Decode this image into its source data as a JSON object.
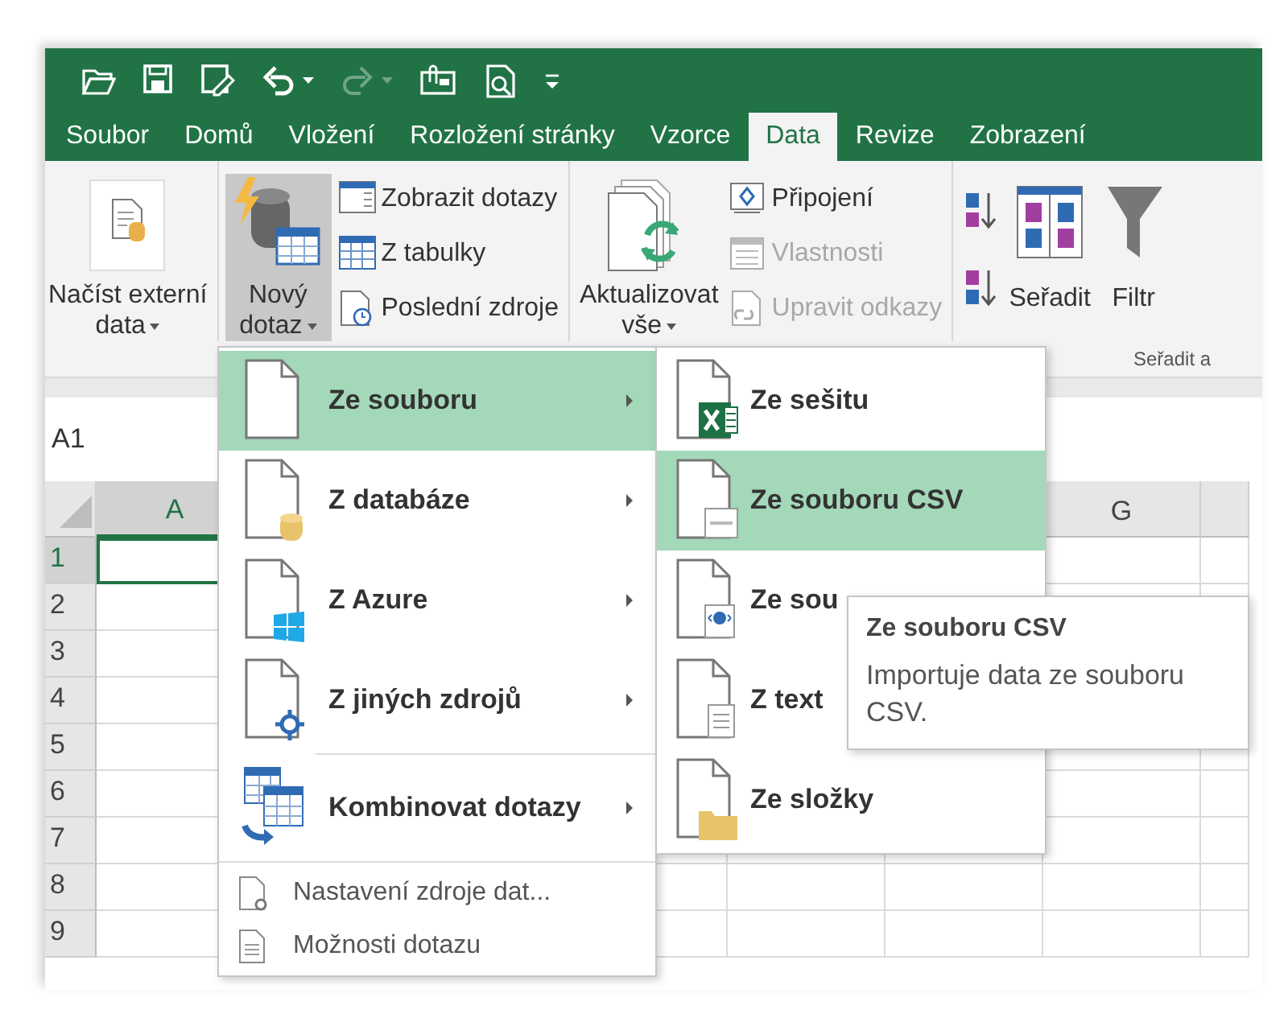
{
  "quick_access": [
    {
      "kind": "open",
      "disabled": false
    },
    {
      "kind": "save",
      "disabled": false
    },
    {
      "kind": "save-edit",
      "disabled": false
    },
    {
      "kind": "undo",
      "disabled": false
    },
    {
      "kind": "dropdown",
      "disabled": false
    },
    {
      "kind": "redo",
      "disabled": true
    },
    {
      "kind": "dropdown",
      "disabled": true
    },
    {
      "kind": "attach",
      "disabled": false
    },
    {
      "kind": "preview",
      "disabled": false
    },
    {
      "kind": "customize",
      "disabled": false
    }
  ],
  "tabs": [
    {
      "label": "Soubor",
      "selected": false
    },
    {
      "label": "Domů",
      "selected": false
    },
    {
      "label": "Vložení",
      "selected": false
    },
    {
      "label": "Rozložení stránky",
      "selected": false
    },
    {
      "label": "Vzorce",
      "selected": false
    },
    {
      "label": "Data",
      "selected": true
    },
    {
      "label": "Revize",
      "selected": false
    },
    {
      "label": "Zobrazení",
      "selected": false
    }
  ],
  "ribbon": {
    "groups": [
      {
        "large": {
          "lines": [
            "Načíst externí",
            "data"
          ],
          "dropdown": true,
          "pressed": false
        }
      },
      {
        "large": {
          "lines": [
            "Nový",
            "dotaz"
          ],
          "dropdown": true,
          "pressed": true
        },
        "small": [
          {
            "label": "Zobrazit dotazy",
            "disabled": false
          },
          {
            "label": "Z tabulky",
            "disabled": false
          },
          {
            "label": "Poslední zdroje",
            "disabled": false
          }
        ]
      },
      {
        "large": {
          "lines": [
            "Aktualizovat",
            "vše"
          ],
          "dropdown": true,
          "pressed": false
        },
        "small": [
          {
            "label": "Připojení",
            "disabled": false
          },
          {
            "label": "Vlastnosti",
            "disabled": true
          },
          {
            "label": "Upravit odkazy",
            "disabled": true
          }
        ]
      }
    ],
    "sort_filter": {
      "sort_label": "Seřadit",
      "filter_label": "Filtr",
      "group_label": "Seřadit a"
    }
  },
  "name_box": "A1",
  "grid": {
    "columns": [
      "A",
      "G"
    ],
    "rows": [
      {
        "label": "1",
        "selected": true
      },
      {
        "label": "2",
        "selected": false
      },
      {
        "label": "3",
        "selected": false
      },
      {
        "label": "4",
        "selected": false
      },
      {
        "label": "5",
        "selected": false
      },
      {
        "label": "6",
        "selected": false
      },
      {
        "label": "7",
        "selected": false
      },
      {
        "label": "8",
        "selected": false
      },
      {
        "label": "9",
        "selected": false
      }
    ]
  },
  "menu": {
    "items": [
      {
        "kind": "submenu",
        "label": "Ze souboru",
        "selected": true,
        "separator_before": false
      },
      {
        "kind": "submenu",
        "label": "Z databáze",
        "selected": false,
        "separator_before": false
      },
      {
        "kind": "submenu",
        "label": "Z Azure",
        "selected": false,
        "separator_before": false
      },
      {
        "kind": "submenu",
        "label": "Z jiných zdrojů",
        "selected": false,
        "separator_before": false
      },
      {
        "kind": "submenu",
        "label": "Kombinovat dotazy",
        "selected": false,
        "separator_before": true
      },
      {
        "kind": "command",
        "label": "Nastavení zdroje dat...",
        "selected": false,
        "separator_before": true
      },
      {
        "kind": "command",
        "label": "Možnosti dotazu",
        "selected": false,
        "separator_before": false
      }
    ]
  },
  "submenu": {
    "items": [
      {
        "label": "Ze sešitu",
        "selected": false
      },
      {
        "label": "Ze souboru CSV",
        "selected": true
      },
      {
        "label": "Ze sou",
        "selected": false
      },
      {
        "label": "Z text",
        "selected": false
      },
      {
        "label": "Ze složky",
        "selected": false
      }
    ]
  },
  "tooltip": {
    "title": "Ze souboru CSV",
    "text": "Importuje data ze souboru CSV."
  }
}
